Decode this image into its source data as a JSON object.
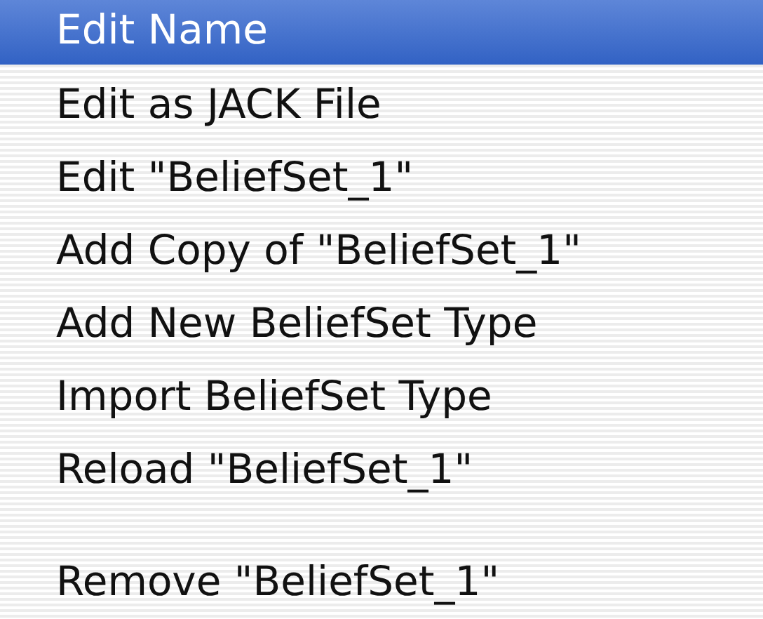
{
  "menu": {
    "items": [
      {
        "kind": "item",
        "label": "Edit Name",
        "selected": true
      },
      {
        "kind": "item",
        "label": "Edit as JACK File",
        "selected": false
      },
      {
        "kind": "item",
        "label": "Edit \"BeliefSet_1\"",
        "selected": false
      },
      {
        "kind": "item",
        "label": "Add Copy of \"BeliefSet_1\"",
        "selected": false
      },
      {
        "kind": "item",
        "label": "Add New BeliefSet Type",
        "selected": false
      },
      {
        "kind": "item",
        "label": "Import BeliefSet Type",
        "selected": false
      },
      {
        "kind": "item",
        "label": "Reload \"BeliefSet_1\"",
        "selected": false
      },
      {
        "kind": "separator"
      },
      {
        "kind": "item",
        "label": "Remove \"BeliefSet_1\"",
        "selected": false
      }
    ]
  }
}
